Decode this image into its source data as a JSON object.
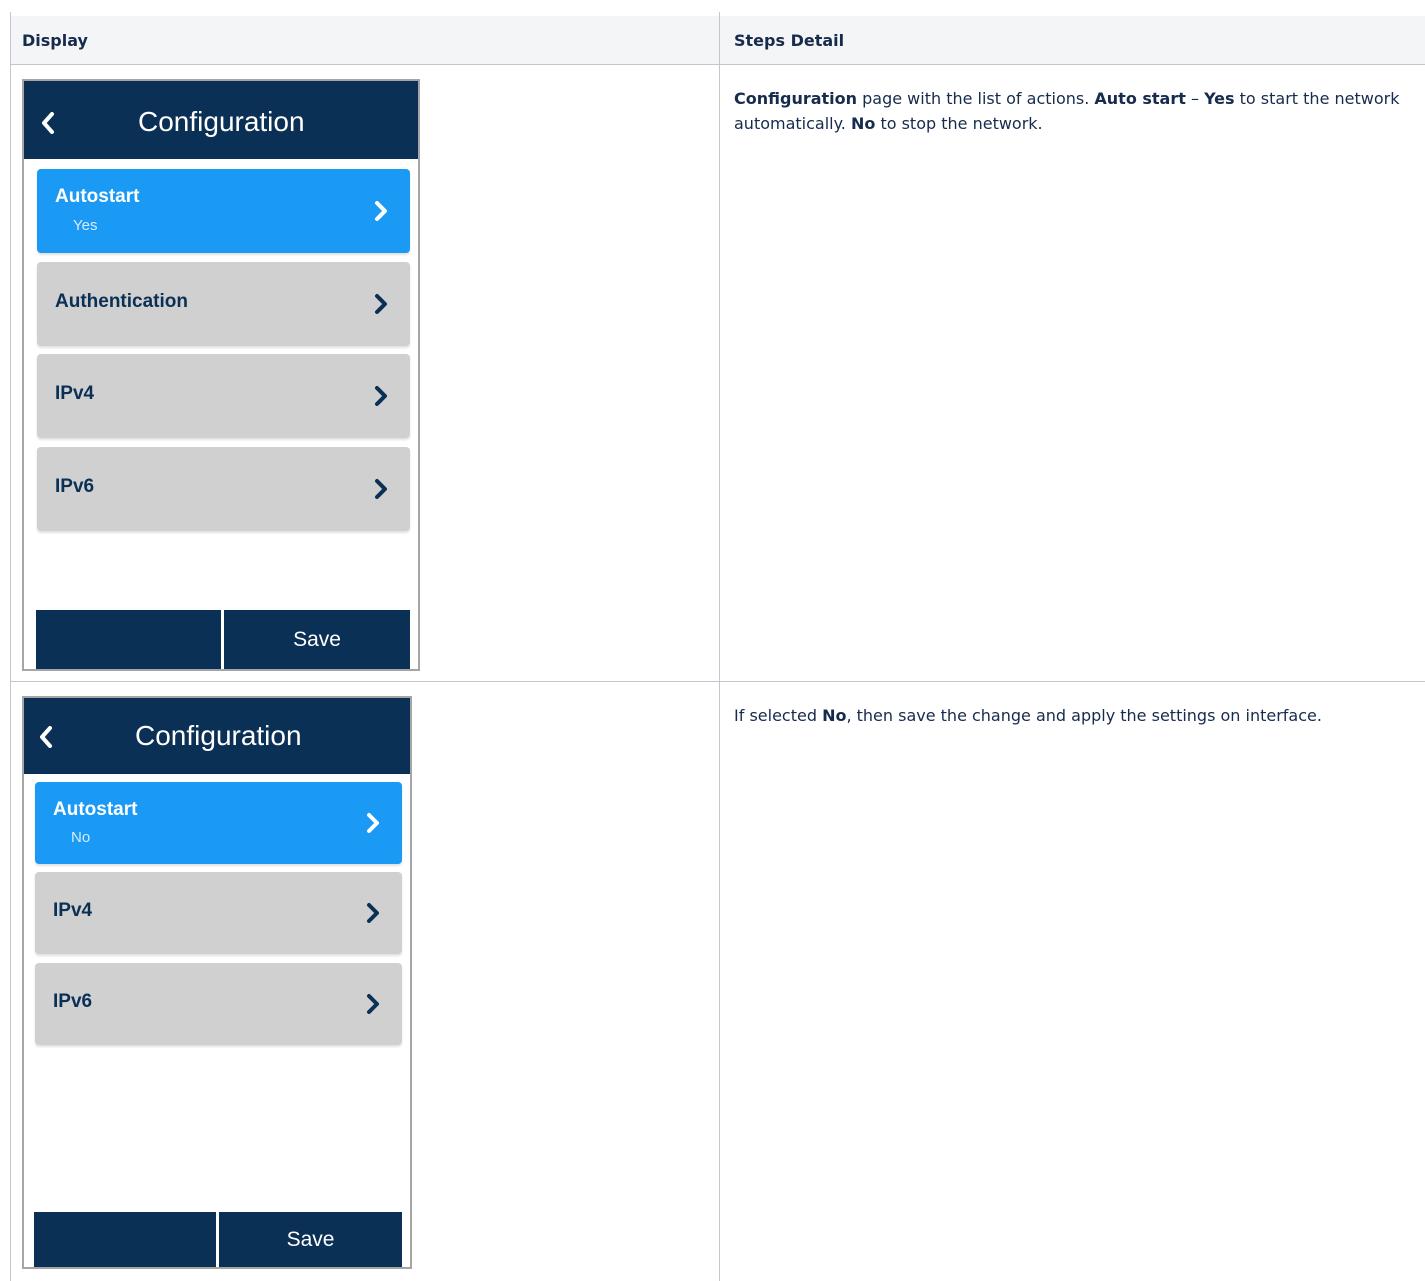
{
  "table": {
    "headers": [
      "Display",
      "Steps Detail"
    ]
  },
  "rows": [
    {
      "screen": {
        "title": "Configuration",
        "items": [
          {
            "label": "Autostart",
            "value": "Yes",
            "selected": true
          },
          {
            "label": "Authentication",
            "value": "",
            "selected": false
          },
          {
            "label": "IPv4",
            "value": "",
            "selected": false
          },
          {
            "label": "IPv6",
            "value": "",
            "selected": false
          }
        ],
        "buttons": [
          "",
          "Save"
        ]
      },
      "detail": {
        "b1": "Configuration",
        "t1": " page with the list of actions. ",
        "b2": "Auto start",
        "t2": " – ",
        "b3": "Yes",
        "t3": " to start the network automatically. ",
        "b4": "No",
        "t4": " to stop the network."
      }
    },
    {
      "screen": {
        "title": "Configuration",
        "items": [
          {
            "label": "Autostart",
            "value": "No",
            "selected": true
          },
          {
            "label": "IPv4",
            "value": "",
            "selected": false
          },
          {
            "label": "IPv6",
            "value": "",
            "selected": false
          }
        ],
        "buttons": [
          "",
          "Save"
        ]
      },
      "detail": {
        "t0": "If selected ",
        "b1": "No",
        "t1": ", then save the change and apply the settings on interface."
      }
    }
  ],
  "colors": {
    "header_navy": "#0b3055",
    "selected_blue": "#1a9af5",
    "item_grey": "#d0d0d0"
  },
  "icons": {
    "back": "chevron-left-icon",
    "forward": "chevron-right-icon"
  }
}
